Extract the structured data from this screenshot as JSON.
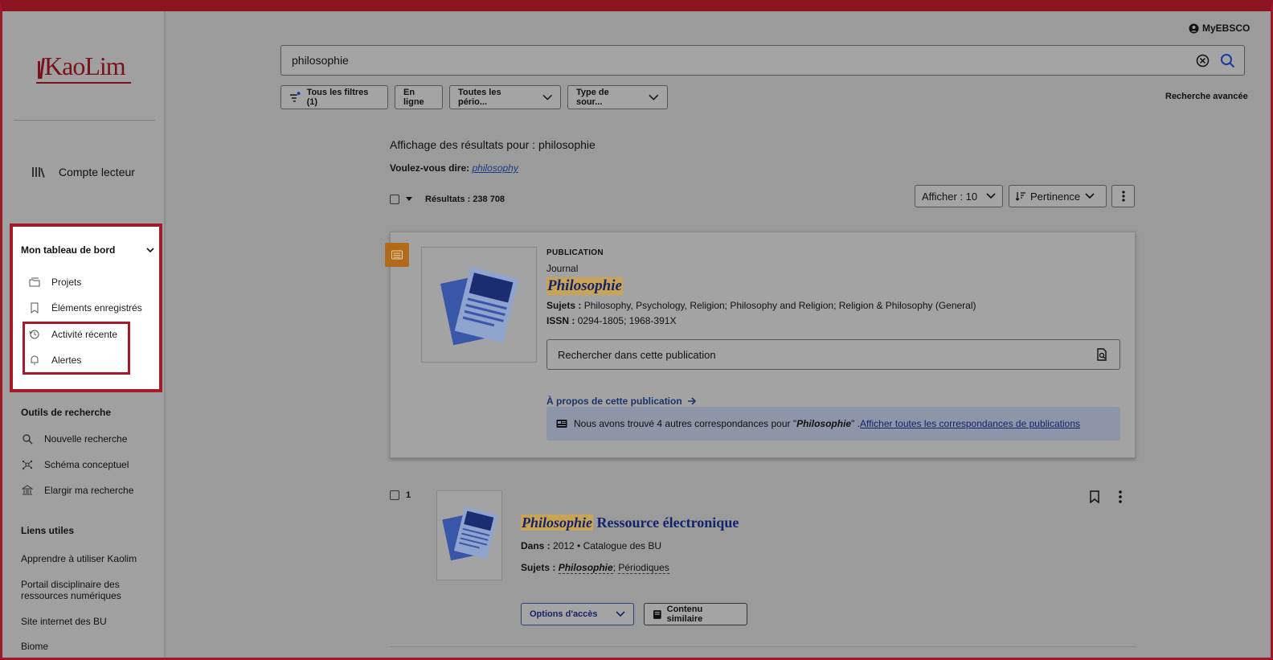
{
  "brand": {
    "logo_text": "KaoLim"
  },
  "account": {
    "label": "Compte lecteur",
    "myebsco": "MyEBSCO"
  },
  "dashboard": {
    "title": "Mon tableau de bord",
    "items": [
      {
        "label": "Projets",
        "icon": "folder-icon"
      },
      {
        "label": "Éléments enregistrés",
        "icon": "bookmark-icon"
      },
      {
        "label": "Activité récente",
        "icon": "history-icon"
      },
      {
        "label": "Alertes",
        "icon": "bell-icon"
      }
    ]
  },
  "tools": {
    "title": "Outils de recherche",
    "items": [
      {
        "label": "Nouvelle recherche",
        "icon": "search-icon"
      },
      {
        "label": "Schéma conceptuel",
        "icon": "concept-map-icon"
      },
      {
        "label": "Elargir ma recherche",
        "icon": "library-icon"
      }
    ]
  },
  "links": {
    "title": "Liens utiles",
    "items": [
      "Apprendre à utiliser Kaolim",
      "Portail disciplinaire des ressources numériques",
      "Site internet des BU",
      "Biome"
    ]
  },
  "search": {
    "value": "philosophie",
    "advanced": "Recherche avancée"
  },
  "filters": {
    "all": "Tous les filtres (1)",
    "online": "En ligne",
    "periods": "Toutes les pério...",
    "source_type": "Type de sour..."
  },
  "results": {
    "heading": "Affichage des résultats pour : philosophie",
    "did_you_mean_label": "Voulez-vous dire:",
    "did_you_mean_value": "philosophy",
    "count": "Résultats : 238 708",
    "show": "Afficher : 10",
    "sort": "Pertinence"
  },
  "publication": {
    "type": "PUBLICATION",
    "subtype": "Journal",
    "title": "Philosophie",
    "subjects_label": "Sujets :",
    "subjects": "Philosophy, Psychology, Religion; Philosophy and Religion; Religion & Philosophy (General)",
    "issn_label": "ISSN :",
    "issn": "0294-1805; 1968-391X",
    "search_placeholder": "Rechercher dans cette publication",
    "about": "À propos de cette publication",
    "notice_pre": "Nous avons trouvé 4 autres correspondances pour \"",
    "notice_term": "Philosophie",
    "notice_mid": "\" .",
    "notice_link": "Afficher toutes les correspondances de publications"
  },
  "result_1": {
    "index": "1",
    "title_highlight": "Philosophie",
    "title_rest": " Ressource électronique",
    "dans_label": "Dans :",
    "dans": "2012 • Catalogue des BU",
    "subjects_label": "Sujets :",
    "subject_1": "Philosophie",
    "subject_sep": "; ",
    "subject_2": "Périodiques",
    "access": "Options d'accès",
    "similar": "Contenu similaire"
  },
  "colors": {
    "brand": "#7a1219",
    "highlight_border": "#a51a2a",
    "accent_orange": "#b06a1a",
    "link": "#14236a"
  }
}
